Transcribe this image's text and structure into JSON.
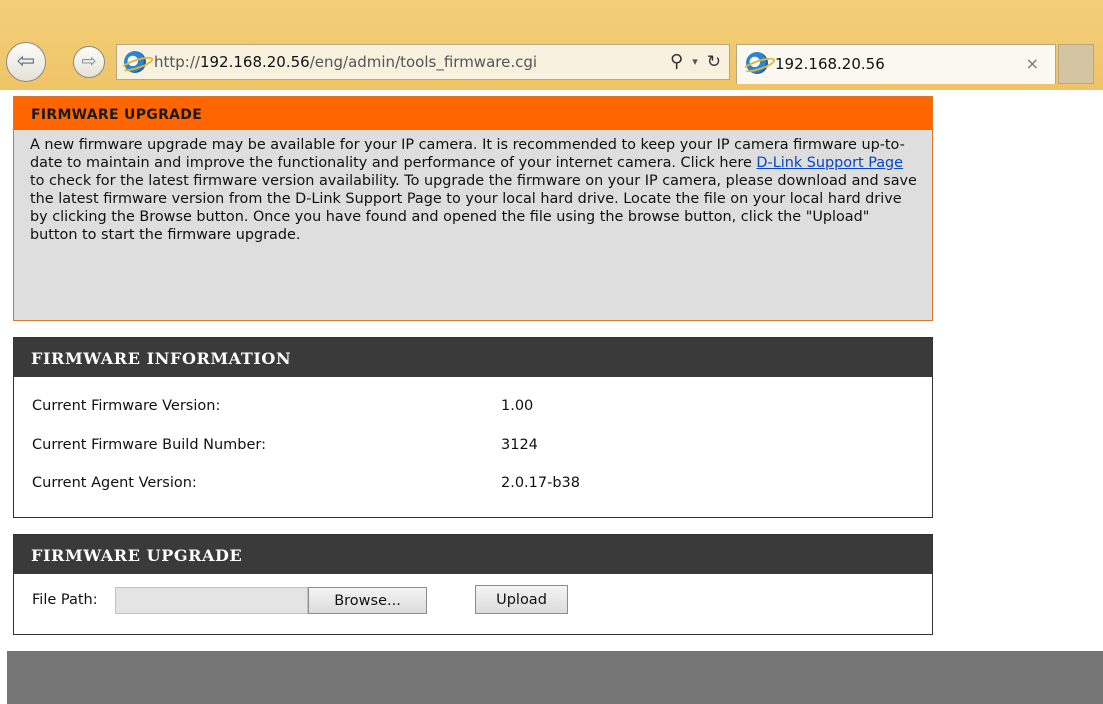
{
  "browser": {
    "back_glyph": "⇦",
    "forward_glyph": "⇨",
    "url_prefix": "http://",
    "url_host": "192.168.20.56",
    "url_path": "/eng/admin/tools_firmware.cgi",
    "search_glyph": "⚲",
    "dropdown_glyph": "▾",
    "refresh_glyph": "↻",
    "tab_title": "192.168.20.56",
    "tab_close": "×",
    "ie_icon": "e"
  },
  "intro_panel": {
    "title": "FIRMWARE UPGRADE",
    "text_before_link": "A new firmware upgrade may be available for your IP camera. It is recommended to keep your IP camera firmware up-to-date to maintain and improve the functionality and performance of your internet camera. Click here ",
    "link_text": "D-Link Support Page ",
    "text_after_link": "to check for the latest firmware version availability. To upgrade the firmware on your IP camera, please download and save the latest firmware version from the D-Link Support Page to your local hard drive. Locate the file on your local hard drive by clicking the Browse button. Once you have found and opened the file using the browse button, click the \"Upload\" button to start the firmware upgrade."
  },
  "info_panel": {
    "title": "FIRMWARE INFORMATION",
    "rows": [
      {
        "label": "Current Firmware Version:",
        "value": "1.00"
      },
      {
        "label": "Current Firmware Build Number:",
        "value": "3124"
      },
      {
        "label": "Current Agent Version:",
        "value": "2.0.17-b38"
      }
    ]
  },
  "upgrade_panel": {
    "title": "FIRMWARE UPGRADE",
    "file_label": "File Path:",
    "file_value": "",
    "browse_label": "Browse...",
    "upload_label": "Upload"
  },
  "colors": {
    "orange_header": "#ff6600",
    "dark_header": "#3a3a3a",
    "footer": "#767676",
    "chrome": "#f1c96f"
  }
}
